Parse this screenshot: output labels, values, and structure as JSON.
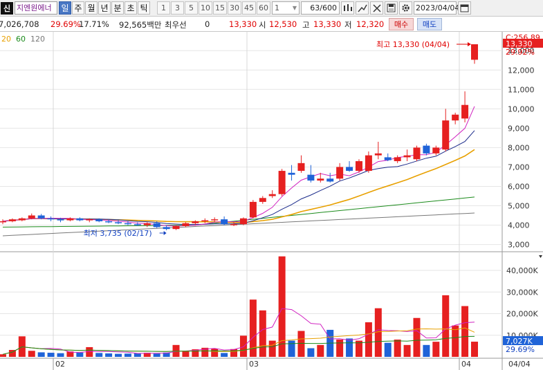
{
  "toolbar": {
    "logo": "신",
    "stock_name": "지엔원에너",
    "periods": [
      {
        "label": "일",
        "active": true
      },
      {
        "label": "주",
        "active": false
      },
      {
        "label": "월",
        "active": false
      },
      {
        "label": "년",
        "active": false
      },
      {
        "label": "분",
        "active": false
      },
      {
        "label": "초",
        "active": false
      },
      {
        "label": "틱",
        "active": false
      }
    ],
    "intervals": [
      "1",
      "3",
      "5",
      "10",
      "15",
      "30",
      "45",
      "60"
    ],
    "interval_select": "1",
    "count": "63/600",
    "date": "2023/04/04"
  },
  "quote": {
    "volume": "7,026,708",
    "change_pct": "29.69%",
    "turnover": "17.71%",
    "amount": "92,565백만",
    "quote_label": "최우선",
    "quote_value": "0",
    "price": "13,330",
    "open_label": "시",
    "open": "12,530",
    "high_label": "고",
    "high": "13,330",
    "low_label": "저",
    "low": "12,320",
    "buy_label": "매수",
    "sell_label": "매도"
  },
  "legend": [
    {
      "label": "20",
      "color": "#e8a000"
    },
    {
      "label": "60",
      "color": "#1a8a1a"
    },
    {
      "label": "120",
      "color": "#777777"
    }
  ],
  "price_axis": {
    "ticks": [
      "13,000",
      "12,000",
      "11,000",
      "10,000",
      "9,000",
      "8,000",
      "7,000",
      "6,000",
      "5,000",
      "4,000",
      "3,000"
    ],
    "top_label": "C:256.89",
    "current_box": "13,330",
    "current_pct": "29.92%"
  },
  "volume_axis": {
    "ticks": [
      "40,000K",
      "30,000K",
      "20,000K",
      "10,000K"
    ],
    "current_box": "7,027K",
    "current_pct": "29.69%"
  },
  "x_axis": {
    "labels": [
      {
        "label": "02",
        "pos": 77
      },
      {
        "label": "03",
        "pos": 357
      },
      {
        "label": "04",
        "pos": 664
      }
    ],
    "right_label": "04/04"
  },
  "annotations": {
    "high": "최고 13,330 (04/04)",
    "low": "최저 3,735 (02/17)"
  },
  "chart_data": {
    "type": "candlestick",
    "price_ylim": [
      2700,
      13900
    ],
    "volume_ylim": [
      0,
      48000
    ],
    "candles": [
      {
        "o": 4150,
        "h": 4300,
        "l": 4050,
        "c": 4200,
        "v": 1200
      },
      {
        "o": 4200,
        "h": 4350,
        "l": 4150,
        "c": 4300,
        "v": 3200
      },
      {
        "o": 4250,
        "h": 4400,
        "l": 4200,
        "c": 4350,
        "v": 9500
      },
      {
        "o": 4350,
        "h": 4600,
        "l": 4300,
        "c": 4500,
        "v": 2800
      },
      {
        "o": 4500,
        "h": 4580,
        "l": 4300,
        "c": 4350,
        "v": 2100
      },
      {
        "o": 4350,
        "h": 4450,
        "l": 4200,
        "c": 4300,
        "v": 1900
      },
      {
        "o": 4300,
        "h": 4380,
        "l": 4150,
        "c": 4250,
        "v": 1700
      },
      {
        "o": 4250,
        "h": 4400,
        "l": 4200,
        "c": 4350,
        "v": 2500
      },
      {
        "o": 4350,
        "h": 4400,
        "l": 4200,
        "c": 4250,
        "v": 2000
      },
      {
        "o": 4250,
        "h": 4350,
        "l": 4150,
        "c": 4300,
        "v": 4500
      },
      {
        "o": 4300,
        "h": 4350,
        "l": 4150,
        "c": 4200,
        "v": 1800
      },
      {
        "o": 4200,
        "h": 4300,
        "l": 4100,
        "c": 4150,
        "v": 1600
      },
      {
        "o": 4150,
        "h": 4250,
        "l": 4050,
        "c": 4100,
        "v": 1400
      },
      {
        "o": 4100,
        "h": 4200,
        "l": 4000,
        "c": 4050,
        "v": 1500
      },
      {
        "o": 4050,
        "h": 4150,
        "l": 3950,
        "c": 4000,
        "v": 1700
      },
      {
        "o": 4000,
        "h": 4150,
        "l": 3900,
        "c": 4100,
        "v": 1900
      },
      {
        "o": 4100,
        "h": 4200,
        "l": 3850,
        "c": 3900,
        "v": 1600
      },
      {
        "o": 3900,
        "h": 4000,
        "l": 3735,
        "c": 3800,
        "v": 2000
      },
      {
        "o": 3800,
        "h": 4000,
        "l": 3750,
        "c": 3950,
        "v": 5500
      },
      {
        "o": 3950,
        "h": 4150,
        "l": 3900,
        "c": 4100,
        "v": 2600
      },
      {
        "o": 4100,
        "h": 4250,
        "l": 4000,
        "c": 4200,
        "v": 3500
      },
      {
        "o": 4200,
        "h": 4350,
        "l": 4100,
        "c": 4250,
        "v": 4200
      },
      {
        "o": 4250,
        "h": 4400,
        "l": 4150,
        "c": 4300,
        "v": 3800
      },
      {
        "o": 4300,
        "h": 4450,
        "l": 4000,
        "c": 4050,
        "v": 1800
      },
      {
        "o": 4050,
        "h": 4150,
        "l": 3950,
        "c": 4050,
        "v": 3600
      },
      {
        "o": 4050,
        "h": 4400,
        "l": 4000,
        "c": 4350,
        "v": 9800
      },
      {
        "o": 4400,
        "h": 5300,
        "l": 4350,
        "c": 5200,
        "v": 26500
      },
      {
        "o": 5200,
        "h": 5500,
        "l": 5100,
        "c": 5400,
        "v": 21500
      },
      {
        "o": 5500,
        "h": 5800,
        "l": 5400,
        "c": 5600,
        "v": 7500
      },
      {
        "o": 5600,
        "h": 6900,
        "l": 5500,
        "c": 6800,
        "v": 46500
      },
      {
        "o": 6700,
        "h": 7100,
        "l": 6300,
        "c": 6600,
        "v": 7500
      },
      {
        "o": 6800,
        "h": 7600,
        "l": 6700,
        "c": 7200,
        "v": 12000
      },
      {
        "o": 6600,
        "h": 7100,
        "l": 6200,
        "c": 6300,
        "v": 4000
      },
      {
        "o": 6300,
        "h": 6700,
        "l": 6200,
        "c": 6400,
        "v": 5500
      },
      {
        "o": 6400,
        "h": 6700,
        "l": 6200,
        "c": 6250,
        "v": 12500
      },
      {
        "o": 6400,
        "h": 7200,
        "l": 6300,
        "c": 7000,
        "v": 8000
      },
      {
        "o": 7000,
        "h": 7300,
        "l": 6750,
        "c": 6800,
        "v": 8500
      },
      {
        "o": 6800,
        "h": 7400,
        "l": 6700,
        "c": 7300,
        "v": 7500
      },
      {
        "o": 6800,
        "h": 7800,
        "l": 6700,
        "c": 7600,
        "v": 16000
      },
      {
        "o": 7600,
        "h": 8300,
        "l": 7400,
        "c": 7700,
        "v": 22500
      },
      {
        "o": 7500,
        "h": 7700,
        "l": 7300,
        "c": 7350,
        "v": 6500
      },
      {
        "o": 7300,
        "h": 7600,
        "l": 7200,
        "c": 7500,
        "v": 8000
      },
      {
        "o": 7500,
        "h": 7900,
        "l": 7300,
        "c": 7600,
        "v": 5500
      },
      {
        "o": 7400,
        "h": 8100,
        "l": 7300,
        "c": 8000,
        "v": 18000
      },
      {
        "o": 8100,
        "h": 8200,
        "l": 7600,
        "c": 7700,
        "v": 5500
      },
      {
        "o": 7700,
        "h": 8100,
        "l": 7600,
        "c": 8000,
        "v": 7000
      },
      {
        "o": 7900,
        "h": 10000,
        "l": 7800,
        "c": 9400,
        "v": 28500
      },
      {
        "o": 9400,
        "h": 9800,
        "l": 9200,
        "c": 9700,
        "v": 14500
      },
      {
        "o": 9500,
        "h": 10900,
        "l": 9300,
        "c": 10200,
        "v": 23500
      },
      {
        "o": 12530,
        "h": 13330,
        "l": 12320,
        "c": 13330,
        "v": 7027
      }
    ]
  }
}
